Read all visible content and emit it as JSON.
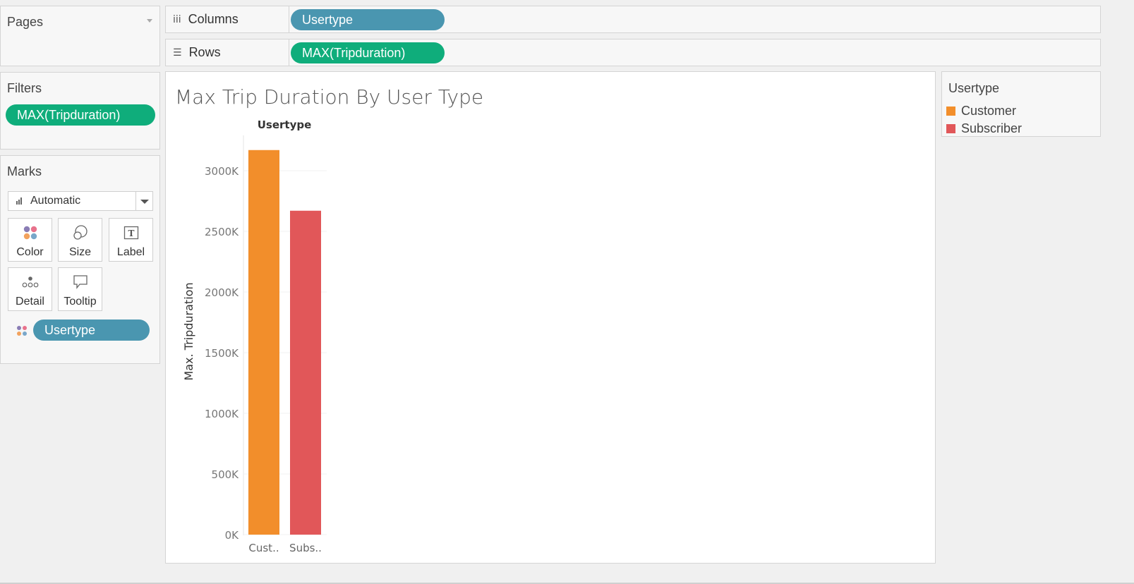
{
  "pages": {
    "title": "Pages"
  },
  "filters": {
    "title": "Filters",
    "pills": [
      {
        "label": "MAX(Tripduration)"
      }
    ]
  },
  "marks": {
    "title": "Marks",
    "mark_type": "Automatic",
    "buttons": [
      {
        "label": "Color",
        "icon": "color-dots-icon"
      },
      {
        "label": "Size",
        "icon": "size-circles-icon"
      },
      {
        "label": "Label",
        "icon": "text-label-icon"
      },
      {
        "label": "Detail",
        "icon": "detail-dots-icon"
      },
      {
        "label": "Tooltip",
        "icon": "speech-bubble-icon"
      }
    ],
    "fields": [
      {
        "label": "Usertype",
        "encoding": "color"
      }
    ]
  },
  "shelves": {
    "columns": {
      "label": "Columns",
      "icon": "columns-icon",
      "pill": "Usertype"
    },
    "rows": {
      "label": "Rows",
      "icon": "rows-icon",
      "pill": "MAX(Tripduration)"
    }
  },
  "legend": {
    "title": "Usertype",
    "items": [
      {
        "label": "Customer",
        "color": "#f28e2b"
      },
      {
        "label": "Subscriber",
        "color": "#e15759"
      }
    ]
  },
  "chart_data": {
    "type": "bar",
    "title": "Max Trip Duration By User Type",
    "column_header": "Usertype",
    "categories": [
      "Cust..",
      "Subs.."
    ],
    "values": [
      3170000,
      2670000
    ],
    "colors": [
      "#f28e2b",
      "#e15759"
    ],
    "ylabel": "Max. Tripduration",
    "ylim": [
      0,
      3000000
    ],
    "yticks": [
      {
        "value": 0,
        "label": "0K"
      },
      {
        "value": 500000,
        "label": "500K"
      },
      {
        "value": 1000000,
        "label": "1000K"
      },
      {
        "value": 1500000,
        "label": "1500K"
      },
      {
        "value": 2000000,
        "label": "2000K"
      },
      {
        "value": 2500000,
        "label": "2500K"
      },
      {
        "value": 3000000,
        "label": "3000K"
      }
    ],
    "grid": true
  }
}
